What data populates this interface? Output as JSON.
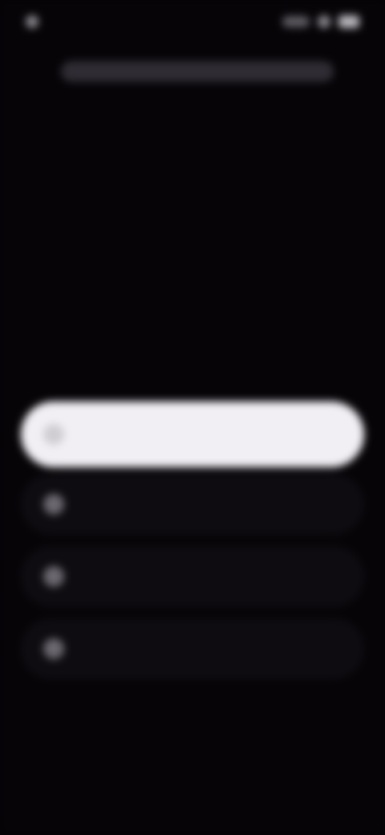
{
  "status_bar": {
    "time": "",
    "icons": [
      "signal-icon",
      "wifi-icon",
      "battery-icon"
    ]
  },
  "top_bar": {
    "text": ""
  },
  "heading": {
    "text": ""
  },
  "options": [
    {
      "label": "",
      "selected": true
    },
    {
      "label": "",
      "selected": false
    },
    {
      "label": "",
      "selected": false
    },
    {
      "label": "",
      "selected": false
    }
  ],
  "footer": {
    "label": ""
  },
  "colors": {
    "background": "#060407",
    "selected_option": "#f1eff3",
    "muted_text": "#9a97a0"
  }
}
